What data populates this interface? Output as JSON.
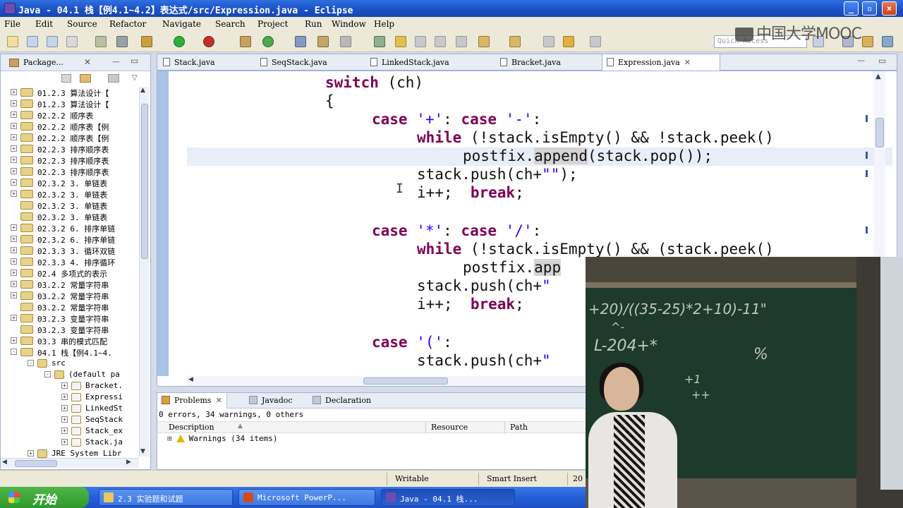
{
  "window": {
    "title": "Java - 04.1  栈【例4.1~4.2】表达式/src/Expression.java - Eclipse"
  },
  "menu": [
    "File",
    "Edit",
    "Source",
    "Refactor",
    "Navigate",
    "Search",
    "Project",
    "Run",
    "Window",
    "Help"
  ],
  "toolbar": {
    "quick_access_placeholder": "Quick Access",
    "watermark": "中国大学MOOC"
  },
  "package_explorer": {
    "title": "Package...",
    "items": [
      {
        "exp": "+",
        "label": "01.2.3  算法设计【"
      },
      {
        "exp": "+",
        "label": "01.2.3  算法设计【"
      },
      {
        "exp": "+",
        "label": "02.2.2  顺序表"
      },
      {
        "exp": "+",
        "label": "02.2.2  顺序表【例"
      },
      {
        "exp": "+",
        "label": "02.2.2  顺序表【例"
      },
      {
        "exp": "+",
        "label": "02.2.3  排序顺序表"
      },
      {
        "exp": "+",
        "label": "02.2.3  排序顺序表"
      },
      {
        "exp": "+",
        "label": "02.2.3  排序顺序表"
      },
      {
        "exp": "+",
        "label": "02.3.2  3. 单链表"
      },
      {
        "exp": "+",
        "label": "02.3.2  3. 单链表"
      },
      {
        "exp": "",
        "label": "02.3.2  3. 单链表"
      },
      {
        "exp": "",
        "label": "02.3.2  3. 单链表"
      },
      {
        "exp": "+",
        "label": "02.3.2  6. 排序单链"
      },
      {
        "exp": "+",
        "label": "02.3.2  6. 排序单链"
      },
      {
        "exp": "+",
        "label": "02.3.3  3. 循环双链"
      },
      {
        "exp": "+",
        "label": "02.3.3  4. 排序循环"
      },
      {
        "exp": "+",
        "label": "02.4  多项式的表示"
      },
      {
        "exp": "+",
        "label": "03.2.2  常量字符串"
      },
      {
        "exp": "+",
        "label": "03.2.2  常量字符串"
      },
      {
        "exp": "",
        "label": "03.2.2  常量字符串"
      },
      {
        "exp": "+",
        "label": "03.2.3  变量字符串"
      },
      {
        "exp": "",
        "label": "03.2.3  变量字符串"
      },
      {
        "exp": "+",
        "label": "03.3  串的模式匹配"
      },
      {
        "exp": "−",
        "label": "04.1  栈【例4.1~4."
      }
    ],
    "children": [
      {
        "indent": 1,
        "exp": "−",
        "label": "src"
      },
      {
        "indent": 2,
        "exp": "−",
        "label": "(default pa"
      },
      {
        "indent": 3,
        "exp": "+",
        "label": "Bracket."
      },
      {
        "indent": 3,
        "exp": "+",
        "label": "Expressi"
      },
      {
        "indent": 3,
        "exp": "+",
        "label": "LinkedSt"
      },
      {
        "indent": 3,
        "exp": "+",
        "label": "SeqStack"
      },
      {
        "indent": 3,
        "exp": "+",
        "label": "Stack_ex"
      },
      {
        "indent": 3,
        "exp": "+",
        "label": "Stack.ja"
      },
      {
        "indent": 1,
        "exp": "+",
        "label": "JRE System Libr"
      }
    ]
  },
  "editor_tabs": [
    "Stack.java",
    "SeqStack.java",
    "LinkedStack.java",
    "Bracket.java",
    "Expression.java"
  ],
  "code": {
    "l1_kw": "switch",
    "l1_rest": " (ch)",
    "l2": "{",
    "l3_kw1": "case",
    "l3_s1": " '+'",
    "l3_c": ": ",
    "l3_kw2": "case",
    "l3_s2": " '-'",
    "l3_e": ":",
    "l4_kw": "while",
    "l4_rest": " (!stack.isEmpty() && !stack.peek()",
    "l5_a": "postfix.",
    "l5_hl": "append",
    "l5_b": "(stack.pop());",
    "l6_a": "stack.push(ch+",
    "l6_s": "\"\"",
    "l6_b": ");",
    "l7_a": "i++;  ",
    "l7_kw": "break",
    "l7_b": ";",
    "l8_kw1": "case",
    "l8_s1": " '*'",
    "l8_c": ": ",
    "l8_kw2": "case",
    "l8_s2": " '/'",
    "l8_e": ":",
    "l9_kw": "while",
    "l9_rest": " (!stack.isEmpty() && (stack.peek()",
    "l10_a": "postfix.",
    "l10_hl": "app",
    "l11_a": "stack.push(ch+",
    "l11_s": "\"",
    "l12_a": "i++;  ",
    "l12_kw": "break",
    "l12_b": ";",
    "l13_kw": "case",
    "l13_s": " '('",
    "l13_e": ":",
    "l14_a": "stack.push(ch+",
    "l14_s": "\"",
    "cursor": "I"
  },
  "problems": {
    "tabs": [
      "Problems",
      "Javadoc",
      "Declaration"
    ],
    "summary": "0 errors, 34 warnings, 0 others",
    "columns": [
      "Description",
      "Resource",
      "Path"
    ],
    "row": "Warnings (34 items)"
  },
  "status": {
    "writable": "Writable",
    "insert_mode": "Smart Insert",
    "position": "20"
  },
  "taskbar": {
    "start": "开始",
    "items": [
      "2.3 实验题和试题",
      "Microsoft PowerP...",
      "Java - 04.1  栈..."
    ]
  },
  "video_chalk": {
    "line1": "+20)/((35-25)*2+10)-11\"",
    "line2": "^-",
    "line3": "L-204+*",
    "line4": "%",
    "line5": "+1",
    "line6": "++"
  },
  "colors": {
    "keyword": "#7f0055",
    "string": "#2a00ff",
    "title_bar": "#1a4fc4"
  }
}
